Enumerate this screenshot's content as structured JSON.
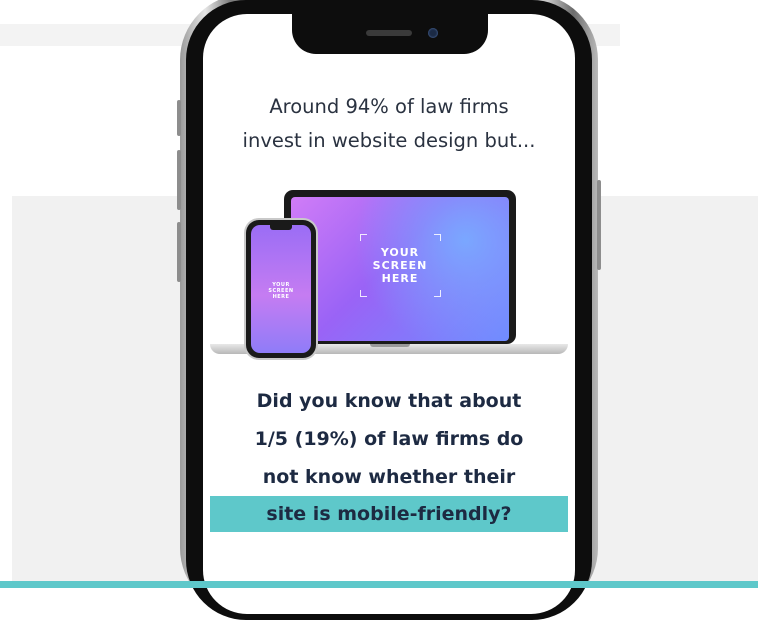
{
  "intro": {
    "line1": "Around 94% of law firms",
    "line2": "invest in website design but..."
  },
  "illustration": {
    "laptop_screen": [
      "YOUR",
      "SCREEN",
      "HERE"
    ],
    "phone_screen": [
      "YOUR",
      "SCREEN",
      "HERE"
    ]
  },
  "question": {
    "line1": "Did you know that about",
    "line2": "1/5 (19%) of law firms do",
    "line3": "not know whether their",
    "highlight": "site is mobile-friendly?"
  },
  "colors": {
    "accent": "#5ec8ca",
    "heading": "#1d2a42",
    "body_text": "#2a3240",
    "panel_background": "#f1f1f1"
  }
}
